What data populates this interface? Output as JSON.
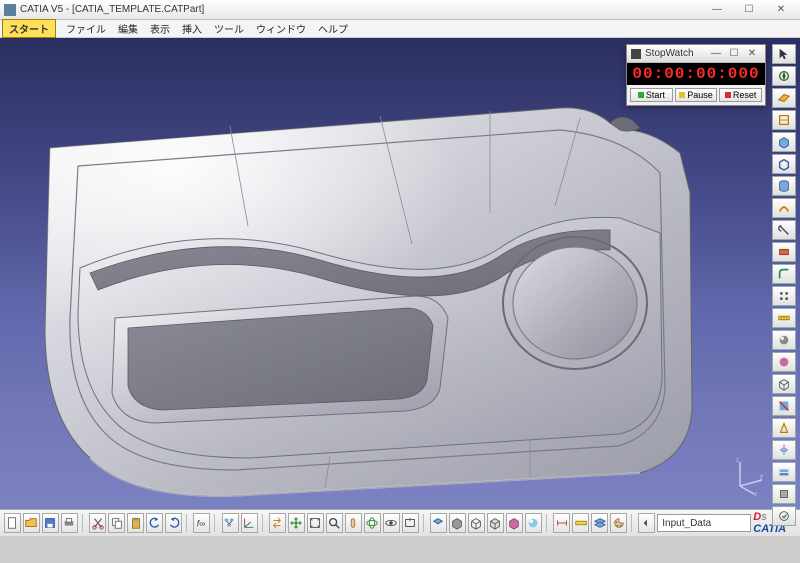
{
  "app": {
    "title": "CATIA V5 - [CATIA_TEMPLATE.CATPart]"
  },
  "menu": {
    "start": "スタート",
    "items": [
      "ファイル",
      "編集",
      "表示",
      "挿入",
      "ツール",
      "ウィンドウ",
      "ヘルプ"
    ]
  },
  "stopwatch": {
    "title": "StopWatch",
    "display": "00:00:00:000",
    "buttons": {
      "start": "Start",
      "pause": "Pause",
      "reset": "Reset"
    }
  },
  "bottom": {
    "input_label": "Input_Data",
    "logo": "CATIA"
  },
  "icons": {
    "right": [
      "cursor",
      "compass",
      "plane-xy",
      "sketch",
      "pad",
      "shell",
      "cylinder",
      "sweep",
      "trim",
      "cut",
      "fillet",
      "pattern",
      "measure",
      "shade",
      "material",
      "wire",
      "section",
      "draft",
      "mirror",
      "thickness",
      "body",
      "toggle"
    ],
    "bottom": [
      "new",
      "open",
      "save",
      "print",
      "sep",
      "cut",
      "copy",
      "paste",
      "undo",
      "redo",
      "sep",
      "fx",
      "sep",
      "tree",
      "axis",
      "sep",
      "swap",
      "arrows",
      "fit",
      "zoom-in",
      "pan",
      "rotate",
      "look",
      "view-normal",
      "sep",
      "iso",
      "shade",
      "wire",
      "hlr",
      "mat",
      "render",
      "sep",
      "measure-dist",
      "measure-item",
      "layer",
      "palette",
      "sep",
      "label"
    ]
  }
}
